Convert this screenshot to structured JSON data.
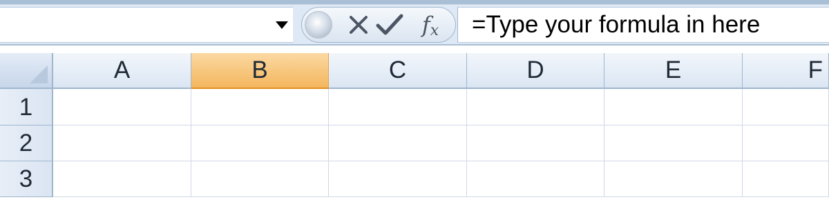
{
  "formula_bar": {
    "name_box_value": "",
    "dropdown_icon": "triangle-down-icon",
    "cancel_icon": "x-icon",
    "enter_icon": "checkmark-icon",
    "function_label_f": "f",
    "function_label_x": "x",
    "formula": "=Type your formula in here"
  },
  "sheet": {
    "columns": [
      "A",
      "B",
      "C",
      "D",
      "E",
      "F"
    ],
    "rows": [
      "1",
      "2",
      "3"
    ],
    "selected_column": "B"
  },
  "colors": {
    "header_blue": "#dbe6f3",
    "selected_orange": "#f4b65d",
    "gridline": "#d0d7e5"
  }
}
